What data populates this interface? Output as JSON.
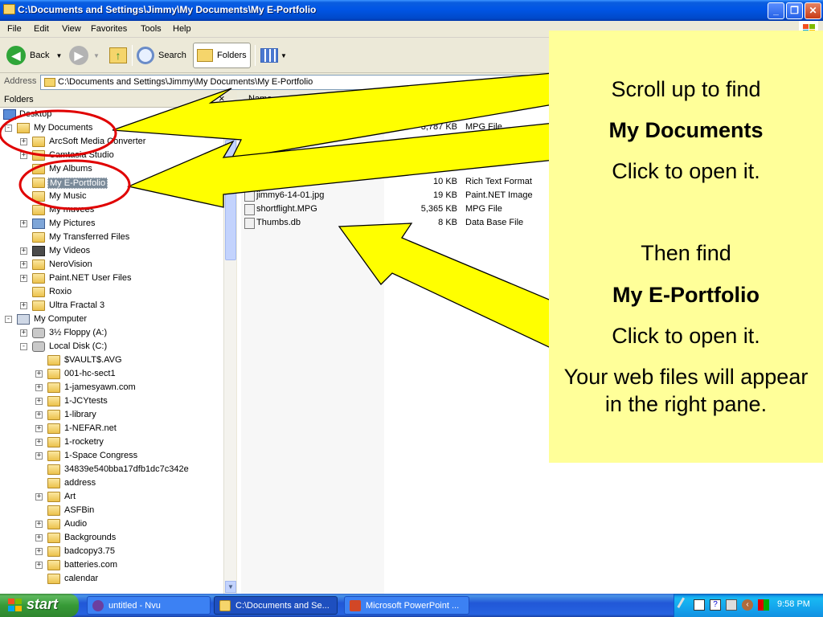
{
  "window": {
    "title": "C:\\Documents and Settings\\Jimmy\\My Documents\\My E-Portfolio",
    "controls": {
      "minimize": "_",
      "maximize": "❐",
      "close": "✕"
    }
  },
  "menu": [
    "File",
    "Edit",
    "View",
    "Favorites",
    "Tools",
    "Help"
  ],
  "toolbar": {
    "back": "Back",
    "search": "Search",
    "folders": "Folders"
  },
  "address": {
    "label": "Address",
    "value": "C:\\Documents and Settings\\Jimmy\\My Documents\\My E-Portfolio"
  },
  "folders_pane": {
    "title": "Folders",
    "close": "×",
    "tree": [
      {
        "label": "Desktop",
        "icon": "desktop-icon"
      },
      {
        "label": "My Documents",
        "icon": "my-documents-icon"
      },
      {
        "label": "ArcSoft Media Converter",
        "icon": "folder-icon"
      },
      {
        "label": "Camtasia Studio",
        "icon": "folder-icon"
      },
      {
        "label": "My Albums",
        "icon": "folder-icon"
      },
      {
        "label": "My E-Portfolio",
        "icon": "folder-open-icon",
        "selected": true
      },
      {
        "label": "My Music",
        "icon": "music-folder-icon"
      },
      {
        "label": "My muvees",
        "icon": "folder-icon"
      },
      {
        "label": "My Pictures",
        "icon": "pictures-folder-icon"
      },
      {
        "label": "My Transferred Files",
        "icon": "folder-icon"
      },
      {
        "label": "My Videos",
        "icon": "videos-folder-icon"
      },
      {
        "label": "NeroVision",
        "icon": "folder-icon"
      },
      {
        "label": "Paint.NET User Files",
        "icon": "folder-icon"
      },
      {
        "label": "Roxio",
        "icon": "folder-icon"
      },
      {
        "label": "Ultra Fractal 3",
        "icon": "folder-icon"
      },
      {
        "label": "My Computer",
        "icon": "my-computer-icon"
      },
      {
        "label": "3½ Floppy (A:)",
        "icon": "floppy-icon"
      },
      {
        "label": "Local Disk (C:)",
        "icon": "disk-icon"
      },
      {
        "label": "$VAULT$.AVG",
        "icon": "folder-icon"
      },
      {
        "label": "001-hc-sect1",
        "icon": "folder-icon"
      },
      {
        "label": "1-jamesyawn.com",
        "icon": "folder-icon"
      },
      {
        "label": "1-JCYtests",
        "icon": "folder-icon"
      },
      {
        "label": "1-library",
        "icon": "folder-icon"
      },
      {
        "label": "1-NEFAR.net",
        "icon": "folder-icon"
      },
      {
        "label": "1-rocketry",
        "icon": "folder-icon"
      },
      {
        "label": "1-Space Congress",
        "icon": "folder-icon"
      },
      {
        "label": "34839e540bba17dfb1dc7c342e",
        "icon": "folder-icon"
      },
      {
        "label": "address",
        "icon": "folder-icon"
      },
      {
        "label": "Art",
        "icon": "folder-icon"
      },
      {
        "label": "ASFBin",
        "icon": "folder-icon"
      },
      {
        "label": "Audio",
        "icon": "folder-icon"
      },
      {
        "label": "Backgrounds",
        "icon": "folder-icon"
      },
      {
        "label": "badcopy3.75",
        "icon": "folder-icon"
      },
      {
        "label": "batteries.com",
        "icon": "folder-icon"
      },
      {
        "label": "calendar",
        "icon": "folder-icon"
      }
    ]
  },
  "file_list": {
    "columns": {
      "name": "Name"
    },
    "files": [
      {
        "name": "",
        "size": "3,787 KB",
        "type": "MPG File"
      },
      {
        "name": "deepwatr.jpg",
        "size": "",
        "type": ""
      },
      {
        "name": "",
        "size": "10 KB",
        "type": "Rich Text Format"
      },
      {
        "name": "jimmy6-14-01.jpg",
        "size": "19 KB",
        "type": "Paint.NET Image"
      },
      {
        "name": "shortflight.MPG",
        "size": "5,365 KB",
        "type": "MPG File"
      },
      {
        "name": "Thumbs.db",
        "size": "8 KB",
        "type": "Data Base File"
      }
    ]
  },
  "callout": {
    "line1": "Scroll up to find",
    "line2": "My Documents",
    "line3": "Click to open it.",
    "line4": "Then find",
    "line5": "My E-Portfolio",
    "line6": "Click to open it.",
    "line7": "Your web files will appear",
    "line8": "in the right pane."
  },
  "taskbar": {
    "start": "start",
    "tasks": [
      {
        "label": "untitled - Nvu",
        "icon": "nvu-icon"
      },
      {
        "label": "C:\\Documents and Se...",
        "icon": "folder-icon",
        "active": true
      },
      {
        "label": "Microsoft PowerPoint ...",
        "icon": "powerpoint-icon"
      }
    ],
    "clock": "9:58 PM"
  },
  "colors": {
    "callout_bg": "#ffff99",
    "arrow_fill": "#ffff00",
    "highlight_ring": "#e00000",
    "titlebar": "#0055e5",
    "taskbar": "#2157d7"
  }
}
